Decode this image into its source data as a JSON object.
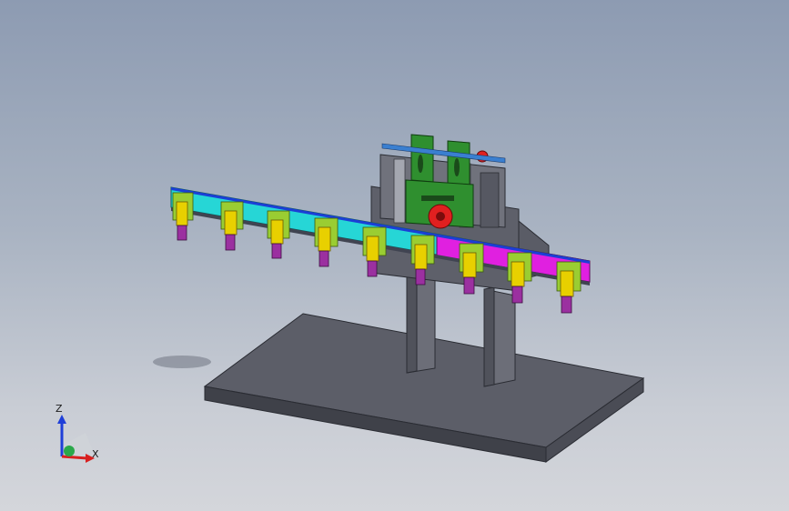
{
  "view": {
    "background_top": "#8d9bb2",
    "background_bottom": "#d4d6db"
  },
  "model": {
    "base_plate_color": "#5c5e68",
    "stand_color": "#6c6e78",
    "beam_segment_colors": [
      "#26d6d6",
      "#e020e0"
    ],
    "frame_color": "#2f8f2f",
    "gripper_color": "#e8d000",
    "gripper_mount_color": "#9acd32",
    "gripper_tip_color": "#9b30a0",
    "accent_red": "#e02020",
    "gripper_count": 9
  },
  "triad": {
    "z_label": "Z",
    "x_label": "X",
    "z_color": "#1f3fd8",
    "x_color": "#d81f1f",
    "y_color": "#2aa84a"
  }
}
